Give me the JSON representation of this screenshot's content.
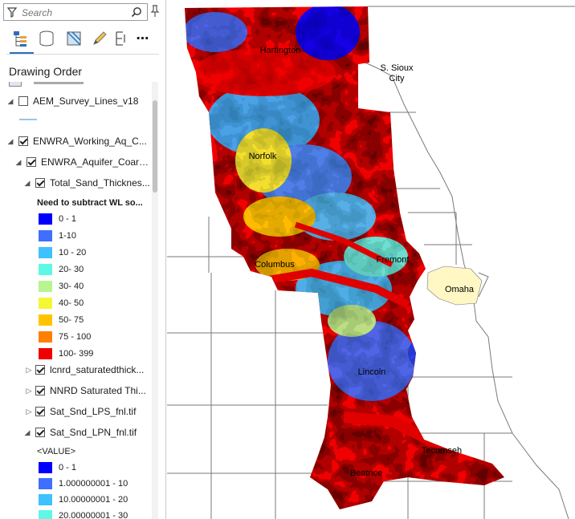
{
  "search": {
    "placeholder": "Search"
  },
  "toolbar": {
    "tools": [
      "list-by-drawing-order-icon",
      "list-by-data-source-icon",
      "list-by-snapping-icon",
      "list-by-editing-icon",
      "list-by-labeling-icon",
      "more-icon"
    ]
  },
  "panel": {
    "heading": "Drawing Order"
  },
  "layers": {
    "aem": "AEM_Survey_Lines_v18",
    "enwra": "ENWRA_Working_Aq_C...",
    "aquifer": "ENWRA_Aquifer_Coars...",
    "total_sand": "Total_Sand_Thicknes...",
    "total_sand_desc": "Need to subtract WL so...",
    "lcnrd": "lcnrd_saturatedthick...",
    "nnrd": "NNRD Saturated Thi...",
    "lps": "Sat_Snd_LPS_fnl.tif",
    "lpn": "Sat_Snd_LPN_fnl.tif",
    "lpn_field": "<VALUE>"
  },
  "legend1": [
    {
      "label": "0 - 1",
      "color": "#0000ff"
    },
    {
      "label": "1-10",
      "color": "#3f6fff"
    },
    {
      "label": "10 - 20",
      "color": "#3ec1ff"
    },
    {
      "label": "20- 30",
      "color": "#5ff7e6"
    },
    {
      "label": "30- 40",
      "color": "#b6f58f"
    },
    {
      "label": "40- 50",
      "color": "#f3f735"
    },
    {
      "label": "50- 75",
      "color": "#ffc400"
    },
    {
      "label": "75 - 100",
      "color": "#ff7f00"
    },
    {
      "label": "100- 399",
      "color": "#f00000"
    }
  ],
  "legend2": [
    {
      "label": "0 - 1",
      "color": "#0000ff"
    },
    {
      "label": "1.000000001 - 10",
      "color": "#3f6fff"
    },
    {
      "label": "10.00000001 - 20",
      "color": "#3ec1ff"
    },
    {
      "label": "20.00000001 - 30",
      "color": "#5ff7e6"
    }
  ],
  "map": {
    "cities": {
      "hartington": "Hartington",
      "sioux_city_1": "S. Sioux",
      "sioux_city_2": "City",
      "norfolk": "Norfolk",
      "columbus": "Columbus",
      "fremont": "Fremont",
      "omaha": "Omaha",
      "lincoln": "Lincoln",
      "tecumseh": "Tecumseh",
      "beatrice": "Beatrice"
    }
  }
}
